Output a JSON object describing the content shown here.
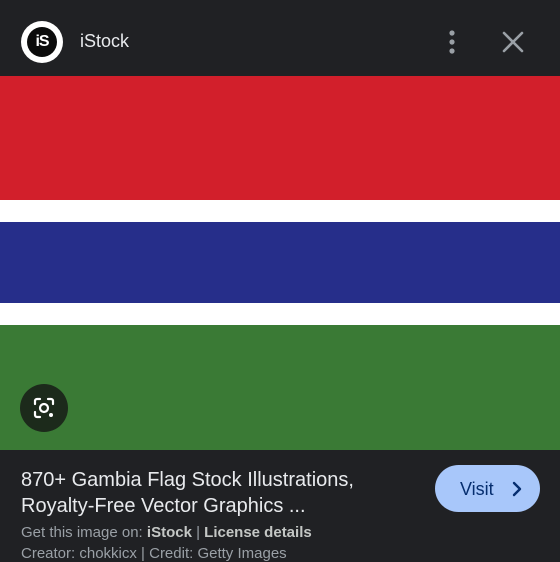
{
  "header": {
    "logo_text": "iS",
    "source_name": "iStock",
    "more_icon": "more-vert-icon",
    "close_icon": "close-icon"
  },
  "image": {
    "description_colors": {
      "red": "#d21f2b",
      "white": "#ffffff",
      "blue": "#262e8a",
      "green": "#3a7a35"
    },
    "lens_icon": "lens-search-icon"
  },
  "result": {
    "title_line1": "870+ Gambia Flag Stock Illustrations,",
    "title_line2": "Royalty-Free Vector Graphics ...",
    "visit_label": "Visit",
    "get_image_prefix": "Get this image on: ",
    "get_image_source": "iStock",
    "separator": " | ",
    "license_label": "License details",
    "creator_label": "Creator: chokkicx",
    "credit_label": "Credit: Getty Images"
  },
  "colors": {
    "background": "#202124",
    "visit_button": "#a8c7fa",
    "visit_text": "#062e6f"
  }
}
